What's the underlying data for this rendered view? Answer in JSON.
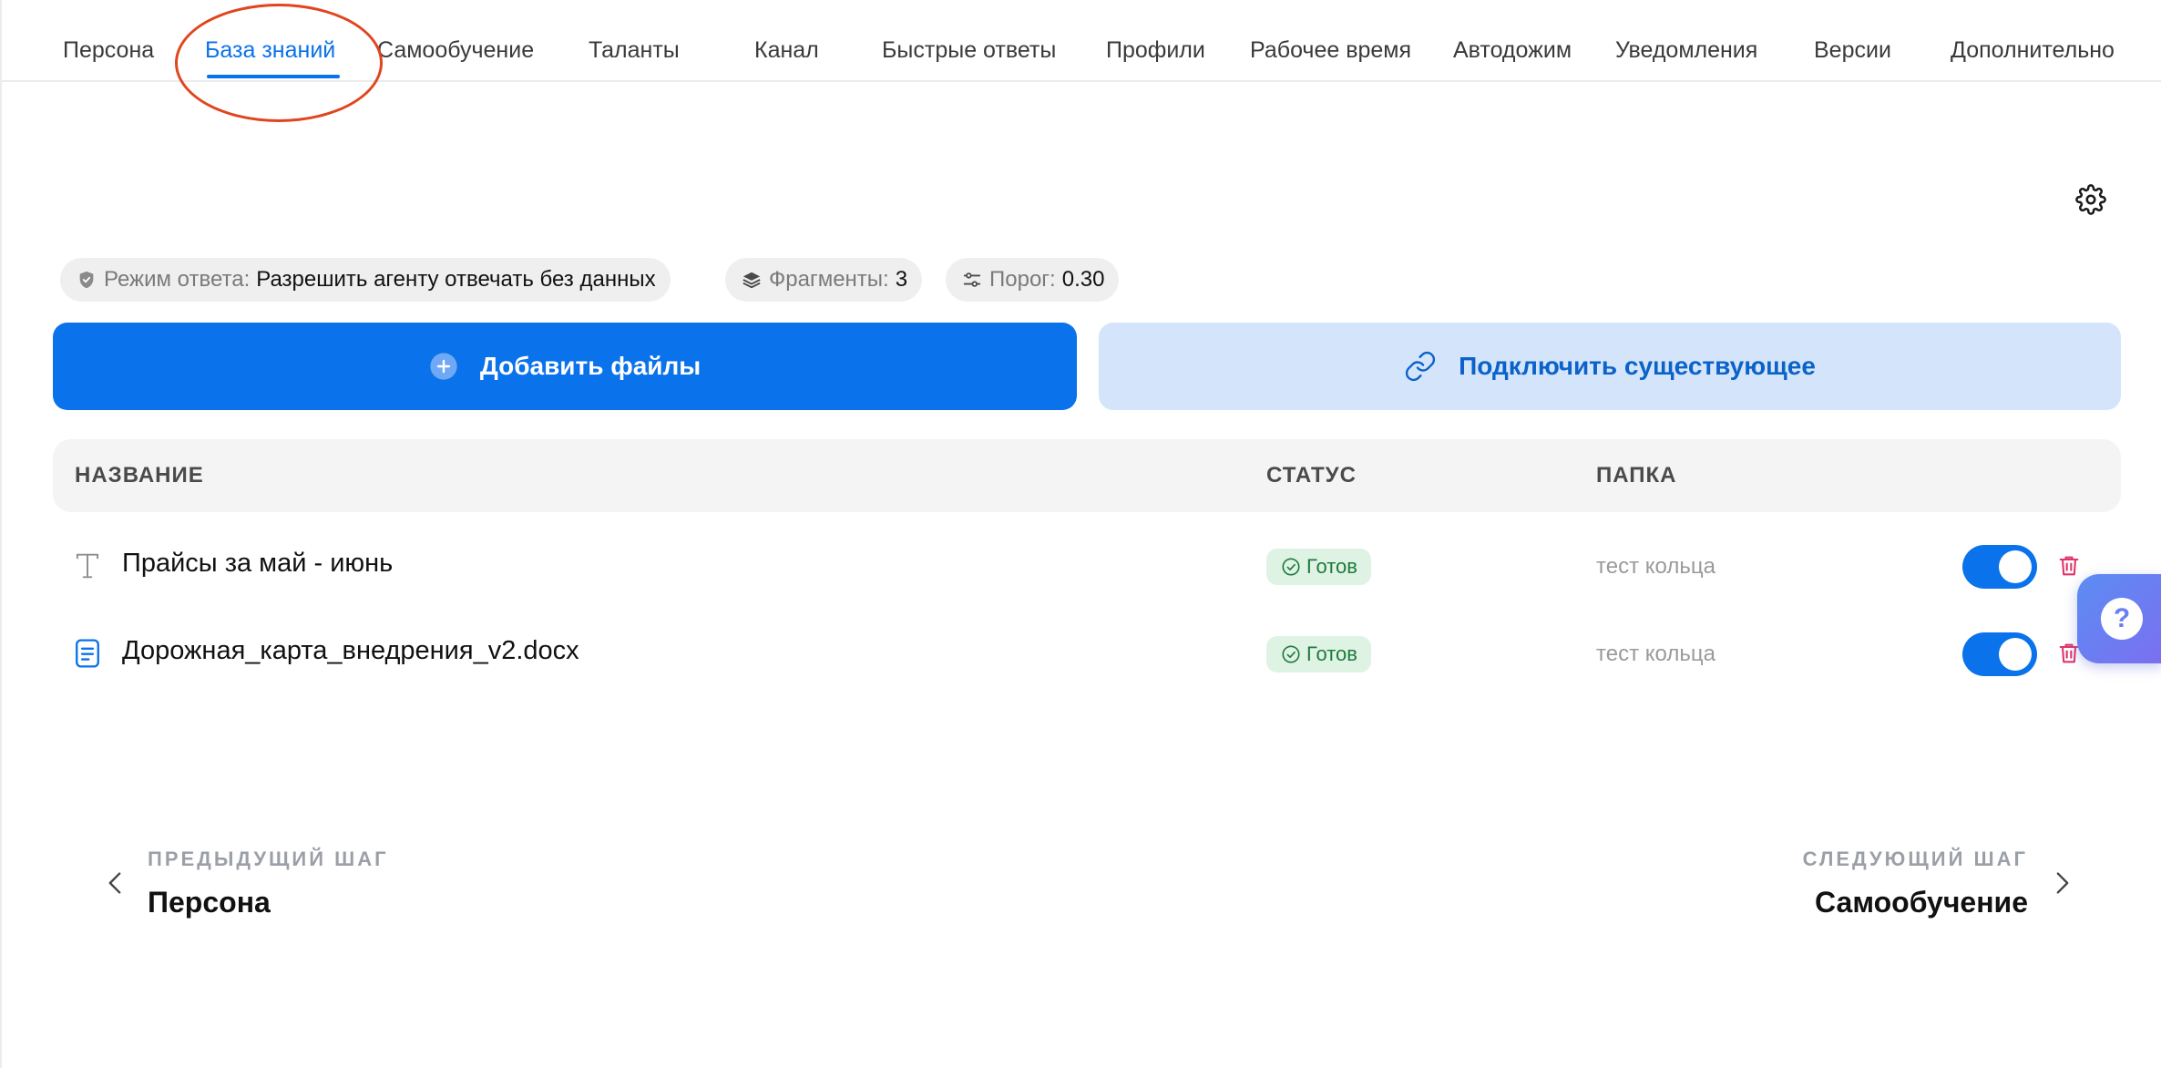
{
  "tabs": [
    {
      "label": "Персона"
    },
    {
      "label": "База знаний",
      "active": true
    },
    {
      "label": "Самообучение"
    },
    {
      "label": "Таланты"
    },
    {
      "label": "Канал"
    },
    {
      "label": "Быстрые ответы"
    },
    {
      "label": "Профили"
    },
    {
      "label": "Рабочее время"
    },
    {
      "label": "Автодожим"
    },
    {
      "label": "Уведомления"
    },
    {
      "label": "Версии"
    },
    {
      "label": "Дополнительно"
    }
  ],
  "settings": {
    "icon": "gear-icon"
  },
  "chips": {
    "mode": {
      "icon": "shield-icon",
      "key": "Режим ответа:",
      "value": "Разрешить агенту отвечать без данных"
    },
    "fragments": {
      "icon": "layers-icon",
      "key": "Фрагменты:",
      "value": "3"
    },
    "threshold": {
      "icon": "sliders-icon",
      "key": "Порог:",
      "value": "0.30"
    }
  },
  "actions": {
    "add_files": {
      "label": "Добавить файлы",
      "icon": "plus-circle-icon"
    },
    "connect_existing": {
      "label": "Подключить существующее",
      "icon": "link-icon"
    }
  },
  "table": {
    "headers": {
      "name": "НАЗВАНИЕ",
      "status": "СТАТУС",
      "folder": "ПАПКА"
    },
    "rows": [
      {
        "icon": "text-type-icon",
        "name": "Прайсы за май - июнь",
        "status": "Готов",
        "folder": "тест кольца",
        "enabled": true
      },
      {
        "icon": "document-icon",
        "name": "Дорожная_карта_внедрения_v2.docx",
        "status": "Готов",
        "folder": "тест кольца",
        "enabled": true
      }
    ]
  },
  "help": {
    "symbol": "?"
  },
  "navigation": {
    "prev": {
      "label": "ПРЕДЫДУЩИЙ ШАГ",
      "title": "Персона"
    },
    "next": {
      "label": "СЛЕДУЮЩИЙ ШАГ",
      "title": "Самообучение"
    }
  },
  "colors": {
    "accent": "#0a72ea",
    "accent_light": "#d4e5fb",
    "status_ready_bg": "#dff3e4",
    "status_ready_text": "#1e7a3c",
    "danger": "#e0356b",
    "annotation": "#e0451e"
  }
}
